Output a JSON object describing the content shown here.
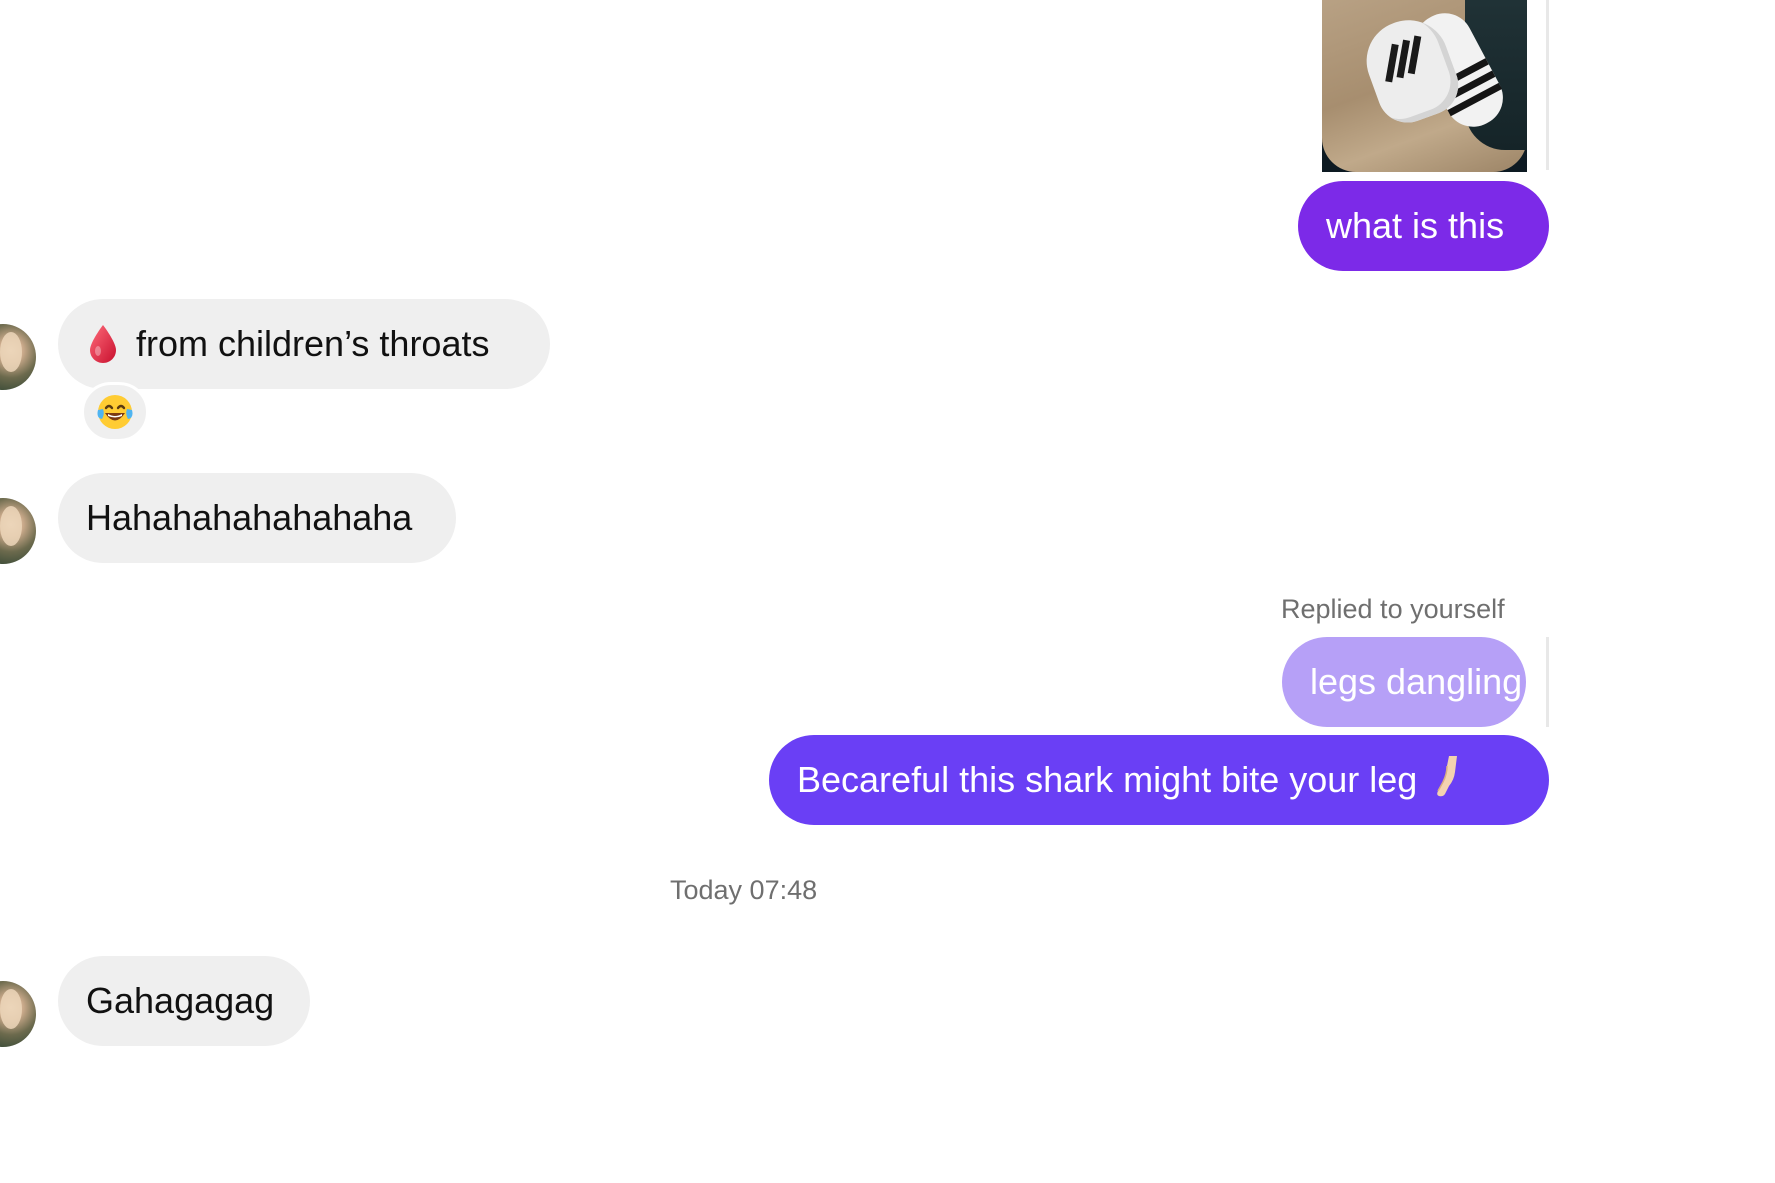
{
  "chat": {
    "outgoing_photo": {
      "alt": "photo of a leg wearing a sneaker and striped sock"
    },
    "messages": {
      "what_is_this": "what is this",
      "from_childrens_throats": "from children’s throats",
      "reaction_emoji": "😂",
      "hahaha": "Hahahahahahahaha",
      "replied_to_label": "Replied to yourself",
      "legs_dangling": "legs dangling",
      "becareful": "Becareful this shark might bite your leg",
      "timestamp": "Today 07:48",
      "gahagagag": "Gahagagag"
    },
    "icons": {
      "drop": "drop-of-blood-icon",
      "laugh": "face-with-tears-of-joy-icon",
      "leg": "leg-icon"
    }
  },
  "colors": {
    "incoming_bubble": "#efefef",
    "outgoing_purple": "#7c2ae8",
    "outgoing_indigo": "#6a3ff5",
    "reply_preview": "#b6a0f7",
    "meta_text": "#6f6f6f"
  }
}
